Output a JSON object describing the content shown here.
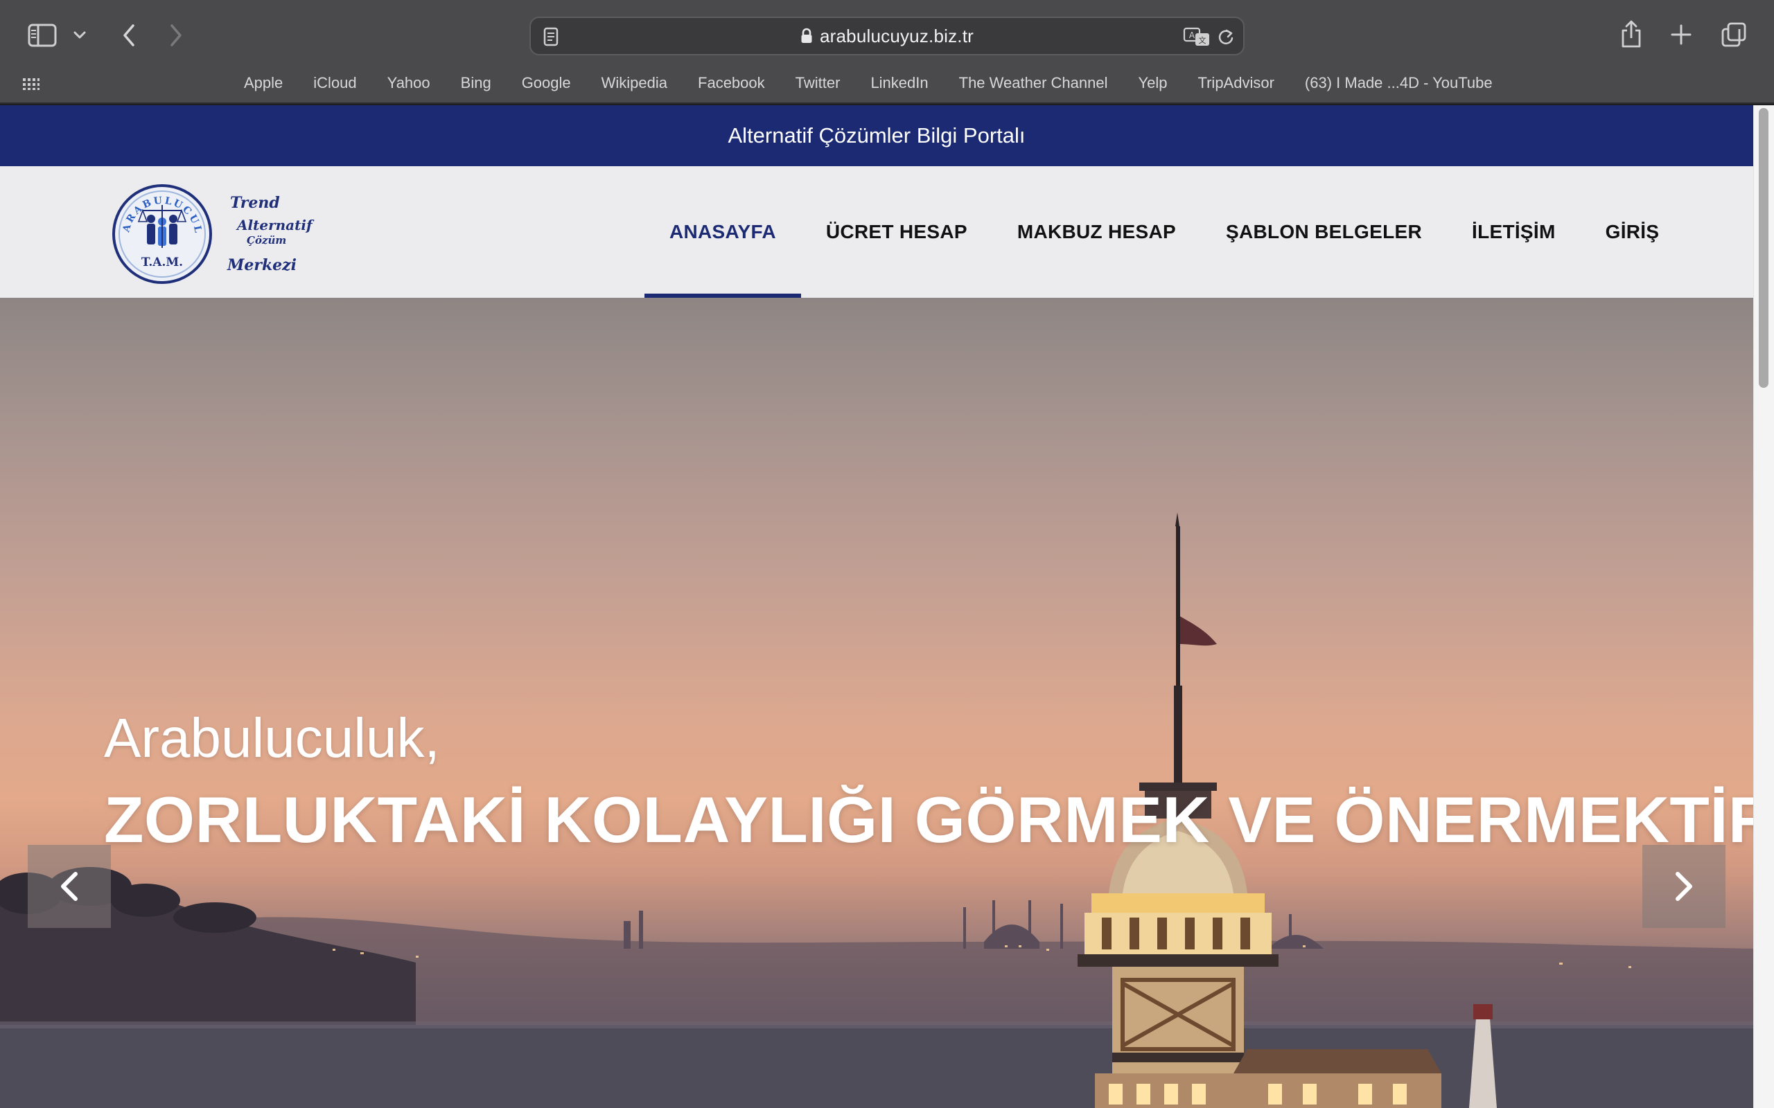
{
  "browser": {
    "url": "arabulucuyuz.biz.tr",
    "favorites": [
      "Apple",
      "iCloud",
      "Yahoo",
      "Bing",
      "Google",
      "Wikipedia",
      "Facebook",
      "Twitter",
      "LinkedIn",
      "The Weather Channel",
      "Yelp",
      "TripAdvisor",
      "(63) I Made ...4D - YouTube"
    ]
  },
  "site": {
    "top_bar": "Alternatif Çözümler Bilgi Portalı",
    "nav": [
      {
        "label": "ANASAYFA",
        "active": true
      },
      {
        "label": "ÜCRET HESAP",
        "active": false
      },
      {
        "label": "MAKBUZ HESAP",
        "active": false
      },
      {
        "label": "ŞABLON BELGELER",
        "active": false
      },
      {
        "label": "İLETİŞİM",
        "active": false
      },
      {
        "label": "GİRİŞ",
        "active": false
      }
    ],
    "logo": {
      "ring_text": "ARABULUCULUK",
      "abbr": "T.A.M.",
      "script_line1": "Trend",
      "script_line2": "Alternatif",
      "script_line3": "Çözüm",
      "script_line4": "Merkezi"
    },
    "hero": {
      "subtitle": "Arabuluculuk,",
      "title": "ZORLUKTAKİ KOLAYLIĞI GÖRMEK VE ÖNERMEKTİR"
    }
  },
  "colors": {
    "brand_navy": "#1b2a73",
    "nav_bg": "#ececef",
    "chrome_bg": "#4a4a4c"
  }
}
